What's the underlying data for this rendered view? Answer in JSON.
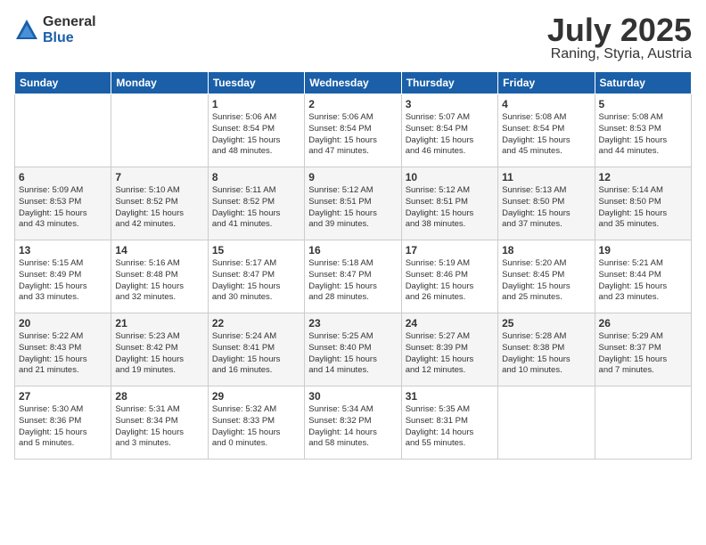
{
  "header": {
    "logo_general": "General",
    "logo_blue": "Blue",
    "month": "July 2025",
    "location": "Raning, Styria, Austria"
  },
  "weekdays": [
    "Sunday",
    "Monday",
    "Tuesday",
    "Wednesday",
    "Thursday",
    "Friday",
    "Saturday"
  ],
  "weeks": [
    [
      {
        "day": "",
        "info": ""
      },
      {
        "day": "",
        "info": ""
      },
      {
        "day": "1",
        "info": "Sunrise: 5:06 AM\nSunset: 8:54 PM\nDaylight: 15 hours\nand 48 minutes."
      },
      {
        "day": "2",
        "info": "Sunrise: 5:06 AM\nSunset: 8:54 PM\nDaylight: 15 hours\nand 47 minutes."
      },
      {
        "day": "3",
        "info": "Sunrise: 5:07 AM\nSunset: 8:54 PM\nDaylight: 15 hours\nand 46 minutes."
      },
      {
        "day": "4",
        "info": "Sunrise: 5:08 AM\nSunset: 8:54 PM\nDaylight: 15 hours\nand 45 minutes."
      },
      {
        "day": "5",
        "info": "Sunrise: 5:08 AM\nSunset: 8:53 PM\nDaylight: 15 hours\nand 44 minutes."
      }
    ],
    [
      {
        "day": "6",
        "info": "Sunrise: 5:09 AM\nSunset: 8:53 PM\nDaylight: 15 hours\nand 43 minutes."
      },
      {
        "day": "7",
        "info": "Sunrise: 5:10 AM\nSunset: 8:52 PM\nDaylight: 15 hours\nand 42 minutes."
      },
      {
        "day": "8",
        "info": "Sunrise: 5:11 AM\nSunset: 8:52 PM\nDaylight: 15 hours\nand 41 minutes."
      },
      {
        "day": "9",
        "info": "Sunrise: 5:12 AM\nSunset: 8:51 PM\nDaylight: 15 hours\nand 39 minutes."
      },
      {
        "day": "10",
        "info": "Sunrise: 5:12 AM\nSunset: 8:51 PM\nDaylight: 15 hours\nand 38 minutes."
      },
      {
        "day": "11",
        "info": "Sunrise: 5:13 AM\nSunset: 8:50 PM\nDaylight: 15 hours\nand 37 minutes."
      },
      {
        "day": "12",
        "info": "Sunrise: 5:14 AM\nSunset: 8:50 PM\nDaylight: 15 hours\nand 35 minutes."
      }
    ],
    [
      {
        "day": "13",
        "info": "Sunrise: 5:15 AM\nSunset: 8:49 PM\nDaylight: 15 hours\nand 33 minutes."
      },
      {
        "day": "14",
        "info": "Sunrise: 5:16 AM\nSunset: 8:48 PM\nDaylight: 15 hours\nand 32 minutes."
      },
      {
        "day": "15",
        "info": "Sunrise: 5:17 AM\nSunset: 8:47 PM\nDaylight: 15 hours\nand 30 minutes."
      },
      {
        "day": "16",
        "info": "Sunrise: 5:18 AM\nSunset: 8:47 PM\nDaylight: 15 hours\nand 28 minutes."
      },
      {
        "day": "17",
        "info": "Sunrise: 5:19 AM\nSunset: 8:46 PM\nDaylight: 15 hours\nand 26 minutes."
      },
      {
        "day": "18",
        "info": "Sunrise: 5:20 AM\nSunset: 8:45 PM\nDaylight: 15 hours\nand 25 minutes."
      },
      {
        "day": "19",
        "info": "Sunrise: 5:21 AM\nSunset: 8:44 PM\nDaylight: 15 hours\nand 23 minutes."
      }
    ],
    [
      {
        "day": "20",
        "info": "Sunrise: 5:22 AM\nSunset: 8:43 PM\nDaylight: 15 hours\nand 21 minutes."
      },
      {
        "day": "21",
        "info": "Sunrise: 5:23 AM\nSunset: 8:42 PM\nDaylight: 15 hours\nand 19 minutes."
      },
      {
        "day": "22",
        "info": "Sunrise: 5:24 AM\nSunset: 8:41 PM\nDaylight: 15 hours\nand 16 minutes."
      },
      {
        "day": "23",
        "info": "Sunrise: 5:25 AM\nSunset: 8:40 PM\nDaylight: 15 hours\nand 14 minutes."
      },
      {
        "day": "24",
        "info": "Sunrise: 5:27 AM\nSunset: 8:39 PM\nDaylight: 15 hours\nand 12 minutes."
      },
      {
        "day": "25",
        "info": "Sunrise: 5:28 AM\nSunset: 8:38 PM\nDaylight: 15 hours\nand 10 minutes."
      },
      {
        "day": "26",
        "info": "Sunrise: 5:29 AM\nSunset: 8:37 PM\nDaylight: 15 hours\nand 7 minutes."
      }
    ],
    [
      {
        "day": "27",
        "info": "Sunrise: 5:30 AM\nSunset: 8:36 PM\nDaylight: 15 hours\nand 5 minutes."
      },
      {
        "day": "28",
        "info": "Sunrise: 5:31 AM\nSunset: 8:34 PM\nDaylight: 15 hours\nand 3 minutes."
      },
      {
        "day": "29",
        "info": "Sunrise: 5:32 AM\nSunset: 8:33 PM\nDaylight: 15 hours\nand 0 minutes."
      },
      {
        "day": "30",
        "info": "Sunrise: 5:34 AM\nSunset: 8:32 PM\nDaylight: 14 hours\nand 58 minutes."
      },
      {
        "day": "31",
        "info": "Sunrise: 5:35 AM\nSunset: 8:31 PM\nDaylight: 14 hours\nand 55 minutes."
      },
      {
        "day": "",
        "info": ""
      },
      {
        "day": "",
        "info": ""
      }
    ]
  ]
}
